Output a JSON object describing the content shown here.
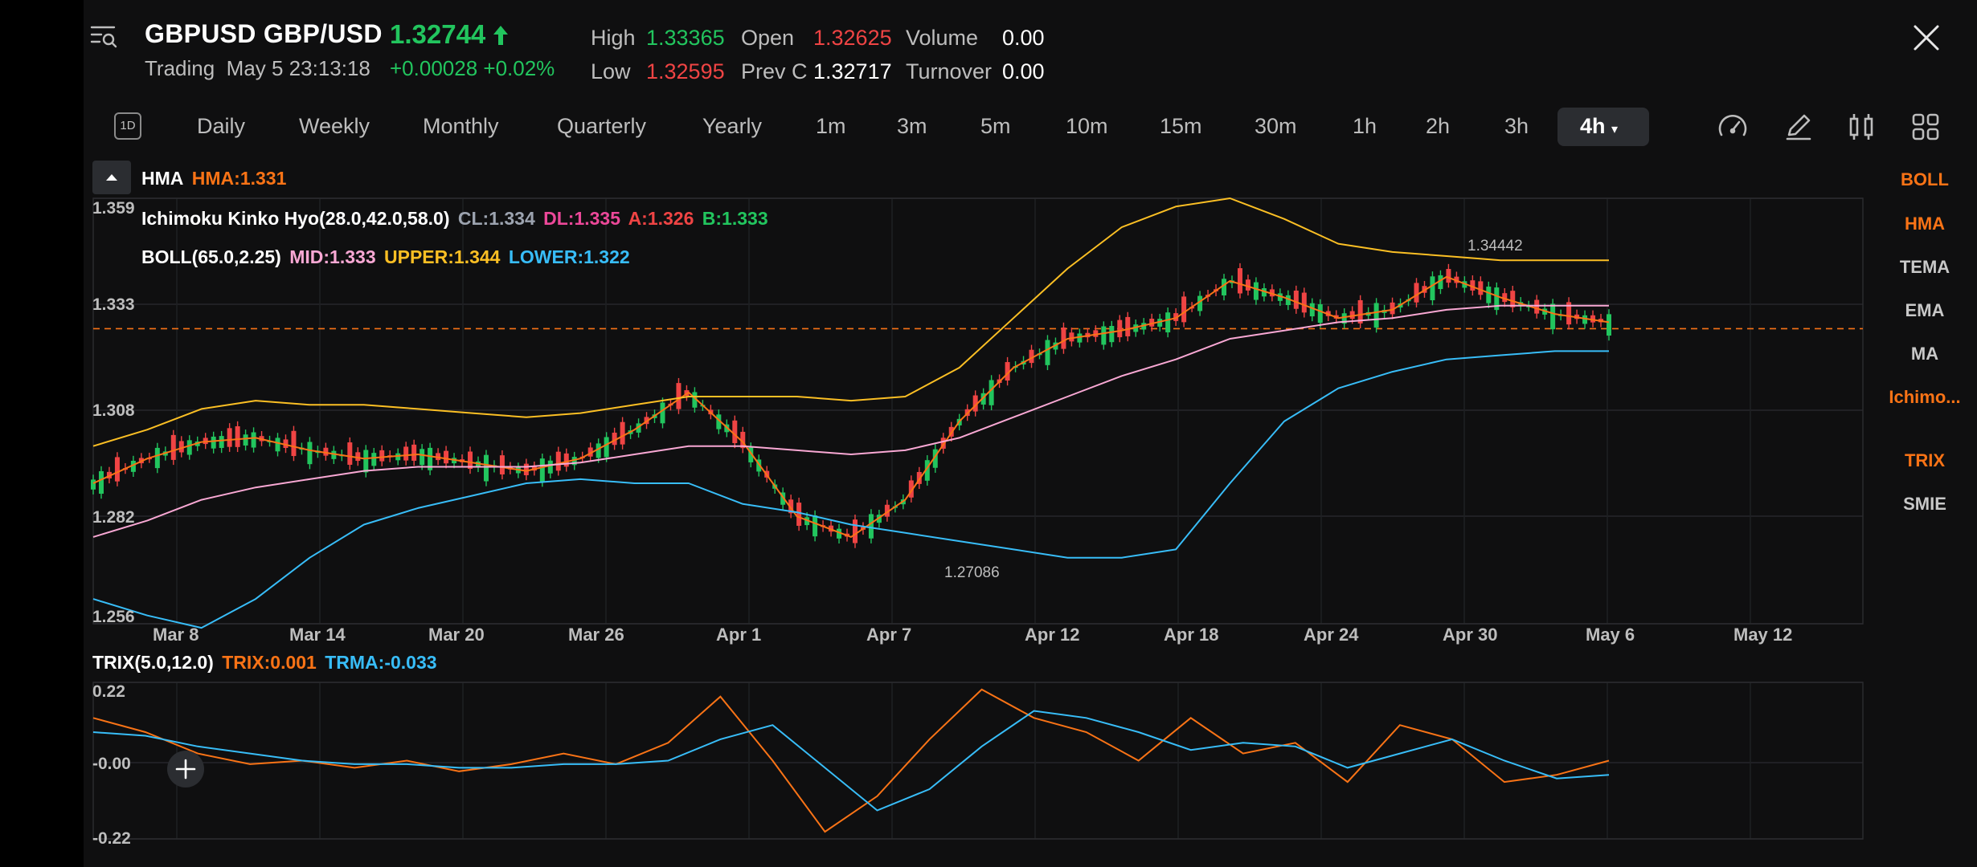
{
  "header": {
    "symbol": "GBPUSD GBP/USD",
    "price": "1.32744",
    "status": "Trading",
    "datetime": "May 5 23:13:18",
    "change": "+0.00028 +0.02%",
    "high_label": "High",
    "high": "1.33365",
    "open_label": "Open",
    "open": "1.32625",
    "volume_label": "Volume",
    "volume": "0.00",
    "low_label": "Low",
    "low": "1.32595",
    "prevc_label": "Prev C",
    "prevc": "1.32717",
    "turnover_label": "Turnover",
    "turnover": "0.00"
  },
  "timeframes": {
    "d1": "1D",
    "items": [
      "Daily",
      "Weekly",
      "Monthly",
      "Quarterly",
      "Yearly",
      "1m",
      "3m",
      "5m",
      "10m",
      "15m",
      "30m",
      "1h",
      "2h",
      "3h"
    ],
    "active": "4h"
  },
  "indicators": {
    "hma_name": "HMA",
    "hma_val": "HMA:1.331",
    "ichi_name": "Ichimoku Kinko Hyo(28.0,42.0,58.0)",
    "ichi_cl": "CL:1.334",
    "ichi_dl": "DL:1.335",
    "ichi_a": "A:1.326",
    "ichi_b": "B:1.333",
    "boll_name": "BOLL(65.0,2.25)",
    "boll_mid": "MID:1.333",
    "boll_upper": "UPPER:1.344",
    "boll_lower": "LOWER:1.322",
    "trix_name": "TRIX(5.0,12.0)",
    "trix_val": "TRIX:0.001",
    "trma_val": "TRMA:-0.033"
  },
  "side_menu": {
    "main": [
      "BOLL",
      "HMA",
      "TEMA",
      "EMA",
      "MA",
      "Ichimo..."
    ],
    "main_active": [
      "BOLL",
      "HMA",
      "Ichimo..."
    ],
    "sub": [
      "TRIX",
      "SMIE"
    ],
    "sub_active": [
      "TRIX"
    ]
  },
  "icons": [
    "search-list-icon",
    "close-icon",
    "arrow-up-icon",
    "gauge-icon",
    "pen-icon",
    "candle-type-icon",
    "grid-icon",
    "plus-icon",
    "collapse-icon"
  ],
  "colors": {
    "up": "#22c55e",
    "down": "#ef4444",
    "accent": "#f97316",
    "hma": "#f97316",
    "boll_mid": "#f9a8d4",
    "boll_upper": "#fbbf24",
    "boll_lower": "#38bdf8",
    "trix": "#f97316",
    "trma": "#38bdf8"
  },
  "chart_data": [
    {
      "type": "line",
      "title": "",
      "y_ticks": [
        "1.359",
        "1.333",
        "1.308",
        "1.282",
        "1.256"
      ],
      "ylim": [
        1.256,
        1.359
      ],
      "x_ticks": [
        "Mar 8",
        "Mar 14",
        "Mar 20",
        "Mar 26",
        "Apr 1",
        "Apr 7",
        "Apr 12",
        "Apr 18",
        "Apr 24",
        "Apr 30",
        "May 6",
        "May 12"
      ],
      "annotations": [
        "1.34442",
        "1.27086"
      ],
      "current_price_line": 1.32744,
      "series": [
        {
          "name": "",
          "values": [
            1.29,
            1.296,
            1.3,
            1.301,
            1.298,
            1.296,
            1.297,
            1.295,
            1.293,
            1.296,
            1.303,
            1.312,
            1.3,
            1.282,
            1.277,
            1.286,
            1.305,
            1.318,
            1.325,
            1.327,
            1.33,
            1.339,
            1.335,
            1.33,
            1.332,
            1.34,
            1.335,
            1.331,
            1.329
          ]
        },
        {
          "name": "",
          "values": [
            1.277,
            1.281,
            1.286,
            1.289,
            1.291,
            1.293,
            1.294,
            1.294,
            1.294,
            1.295,
            1.297,
            1.299,
            1.299,
            1.298,
            1.297,
            1.298,
            1.301,
            1.306,
            1.311,
            1.316,
            1.32,
            1.325,
            1.327,
            1.329,
            1.33,
            1.332,
            1.333,
            1.333,
            1.333
          ]
        },
        {
          "name": "",
          "values": [
            1.299,
            1.303,
            1.308,
            1.31,
            1.309,
            1.309,
            1.308,
            1.307,
            1.306,
            1.307,
            1.309,
            1.311,
            1.311,
            1.311,
            1.31,
            1.311,
            1.318,
            1.33,
            1.342,
            1.352,
            1.357,
            1.359,
            1.354,
            1.348,
            1.346,
            1.345,
            1.344,
            1.344,
            1.344
          ]
        },
        {
          "name": "",
          "values": [
            1.262,
            1.258,
            1.255,
            1.262,
            1.272,
            1.28,
            1.284,
            1.287,
            1.29,
            1.291,
            1.29,
            1.29,
            1.285,
            1.283,
            1.28,
            1.278,
            1.276,
            1.274,
            1.272,
            1.272,
            1.274,
            1.29,
            1.305,
            1.313,
            1.317,
            1.32,
            1.321,
            1.322,
            1.322
          ]
        }
      ]
    },
    {
      "type": "line",
      "title": "",
      "y_ticks": [
        "0.22",
        "-0.00",
        "-0.22"
      ],
      "ylim": [
        -0.22,
        0.22
      ],
      "series": [
        {
          "name": "",
          "values": [
            0.12,
            0.08,
            0.02,
            -0.01,
            0.0,
            -0.02,
            0.0,
            -0.03,
            -0.01,
            0.02,
            -0.01,
            0.05,
            0.18,
            0.0,
            -0.2,
            -0.1,
            0.06,
            0.2,
            0.12,
            0.08,
            0.0,
            0.12,
            0.02,
            0.05,
            -0.06,
            0.1,
            0.06,
            -0.06,
            -0.04,
            0.0
          ]
        },
        {
          "name": "",
          "values": [
            0.08,
            0.07,
            0.04,
            0.02,
            0.0,
            -0.01,
            -0.01,
            -0.02,
            -0.02,
            -0.01,
            -0.01,
            0.0,
            0.06,
            0.1,
            -0.02,
            -0.14,
            -0.08,
            0.04,
            0.14,
            0.12,
            0.08,
            0.03,
            0.05,
            0.04,
            -0.02,
            0.02,
            0.06,
            0.0,
            -0.05,
            -0.04
          ]
        }
      ]
    }
  ]
}
